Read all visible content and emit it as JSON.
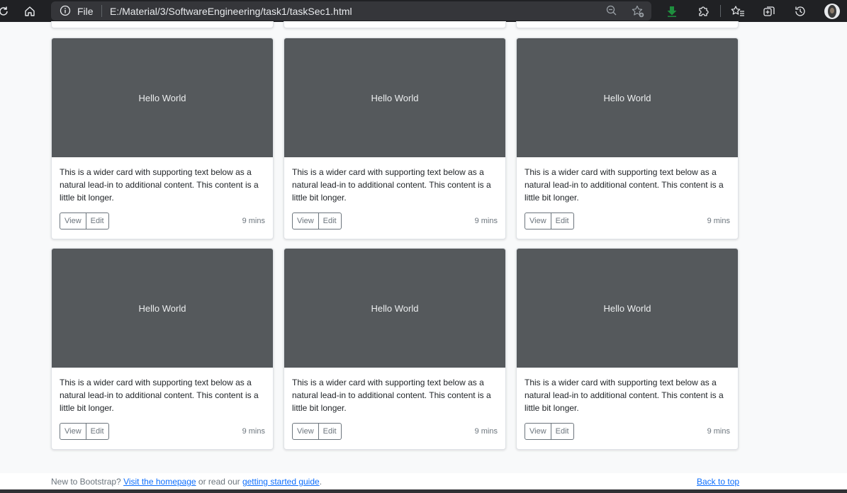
{
  "browser": {
    "scheme_label": "File",
    "url": "E:/Material/3/SoftwareEngineering/task1/taskSec1.html",
    "icons": [
      "refresh-icon",
      "home-icon",
      "info-icon",
      "zoom-out-icon",
      "add-favorite-icon",
      "download-icon",
      "extensions-icon",
      "favorites-icon",
      "collections-icon",
      "history-icon",
      "profile-avatar"
    ],
    "accent_download": "#1e8e3e"
  },
  "cards": [
    {
      "image_text": "Hello World",
      "text": "This is a wider card with supporting text below as a natural lead-in to additional content. This content is a little bit longer.",
      "view_label": "View",
      "edit_label": "Edit",
      "meta": "9 mins"
    },
    {
      "image_text": "Hello World",
      "text": "This is a wider card with supporting text below as a natural lead-in to additional content. This content is a little bit longer.",
      "view_label": "View",
      "edit_label": "Edit",
      "meta": "9 mins"
    },
    {
      "image_text": "Hello World",
      "text": "This is a wider card with supporting text below as a natural lead-in to additional content. This content is a little bit longer.",
      "view_label": "View",
      "edit_label": "Edit",
      "meta": "9 mins"
    },
    {
      "image_text": "Hello World",
      "text": "This is a wider card with supporting text below as a natural lead-in to additional content. This content is a little bit longer.",
      "view_label": "View",
      "edit_label": "Edit",
      "meta": "9 mins"
    },
    {
      "image_text": "Hello World",
      "text": "This is a wider card with supporting text below as a natural lead-in to additional content. This content is a little bit longer.",
      "view_label": "View",
      "edit_label": "Edit",
      "meta": "9 mins"
    },
    {
      "image_text": "Hello World",
      "text": "This is a wider card with supporting text below as a natural lead-in to additional content. This content is a little bit longer.",
      "view_label": "View",
      "edit_label": "Edit",
      "meta": "9 mins"
    }
  ],
  "footer": {
    "prefix": "New to Bootstrap? ",
    "homepage_link": "Visit the homepage",
    "middle": " or read our ",
    "guide_link": "getting started guide",
    "suffix": ".",
    "back_to_top": "Back to top"
  },
  "colors": {
    "page_bg": "#f8f9fa",
    "thumb_bg": "#55595c",
    "link": "#0d6efd",
    "toolbar_bg": "#202124"
  }
}
